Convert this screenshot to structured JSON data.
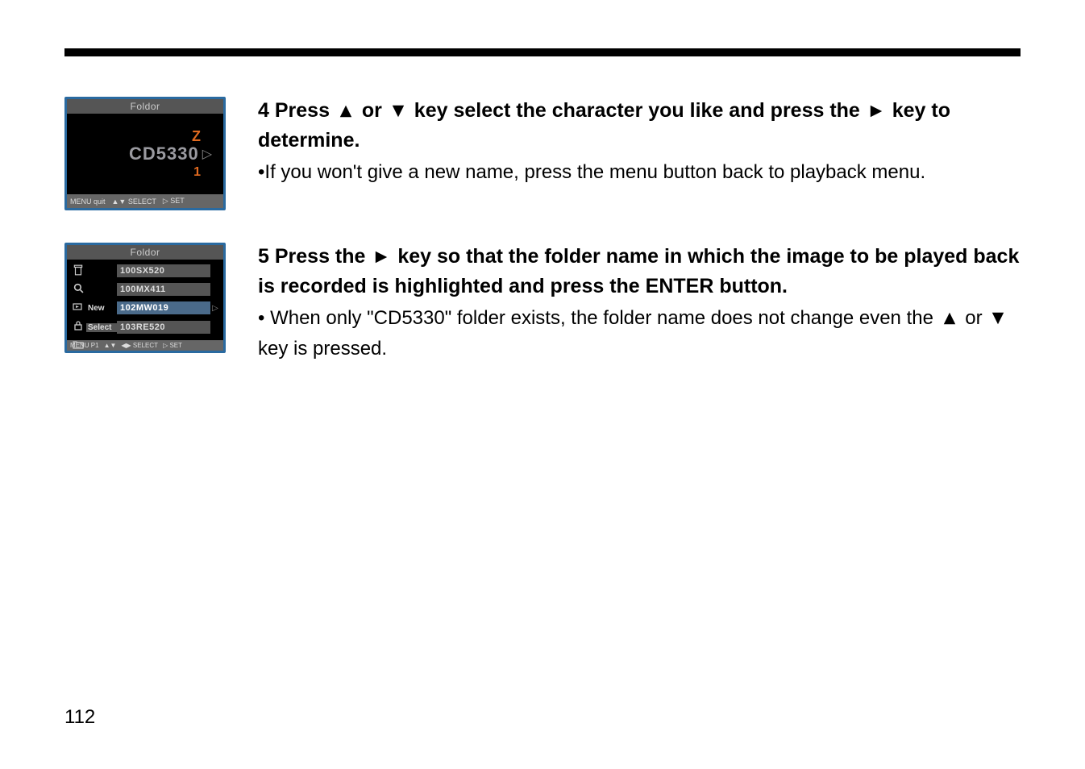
{
  "lcd1": {
    "title": "Foldor",
    "z": "Z",
    "code": "CD5330",
    "one": "1",
    "footer_menu": "MENU quit",
    "footer_sel": "▲▼ SELECT",
    "footer_set": "▷ SET"
  },
  "lcd2": {
    "title": "Foldor",
    "rows": [
      {
        "icon": "trash",
        "tag": "",
        "val": "100SX520",
        "hl": false
      },
      {
        "icon": "search",
        "tag": "",
        "val": "100MX411",
        "hl": false
      },
      {
        "icon": "slide",
        "tag": "New",
        "val": "102MW019",
        "hl": true
      },
      {
        "icon": "lock",
        "tag": "",
        "val": "",
        "hl": false
      },
      {
        "icon": "folder",
        "tag": "Select",
        "val": "103RE520",
        "hl": false
      }
    ],
    "footer_menu": "MENU P1",
    "footer_av": "▲▼",
    "footer_lr": "◀▶ SELECT",
    "footer_set": "▷ SET"
  },
  "step4": {
    "num": "4",
    "head_a": "Press",
    "head_b": "or",
    "head_c": "key select the character you like and press the",
    "head_d": "key to determine.",
    "note": "•If you won't give a new name, press the menu button back to playback menu."
  },
  "step5": {
    "num": "5",
    "head_a": "Press the",
    "head_b": "key so that the folder name in which the image to be played back is recorded is highlighted and press the ENTER button.",
    "note_a": "• When only \"CD5330\" folder exists, the folder name does not change even the",
    "note_b": "or",
    "note_c": "key is pressed."
  },
  "page_number": "112"
}
